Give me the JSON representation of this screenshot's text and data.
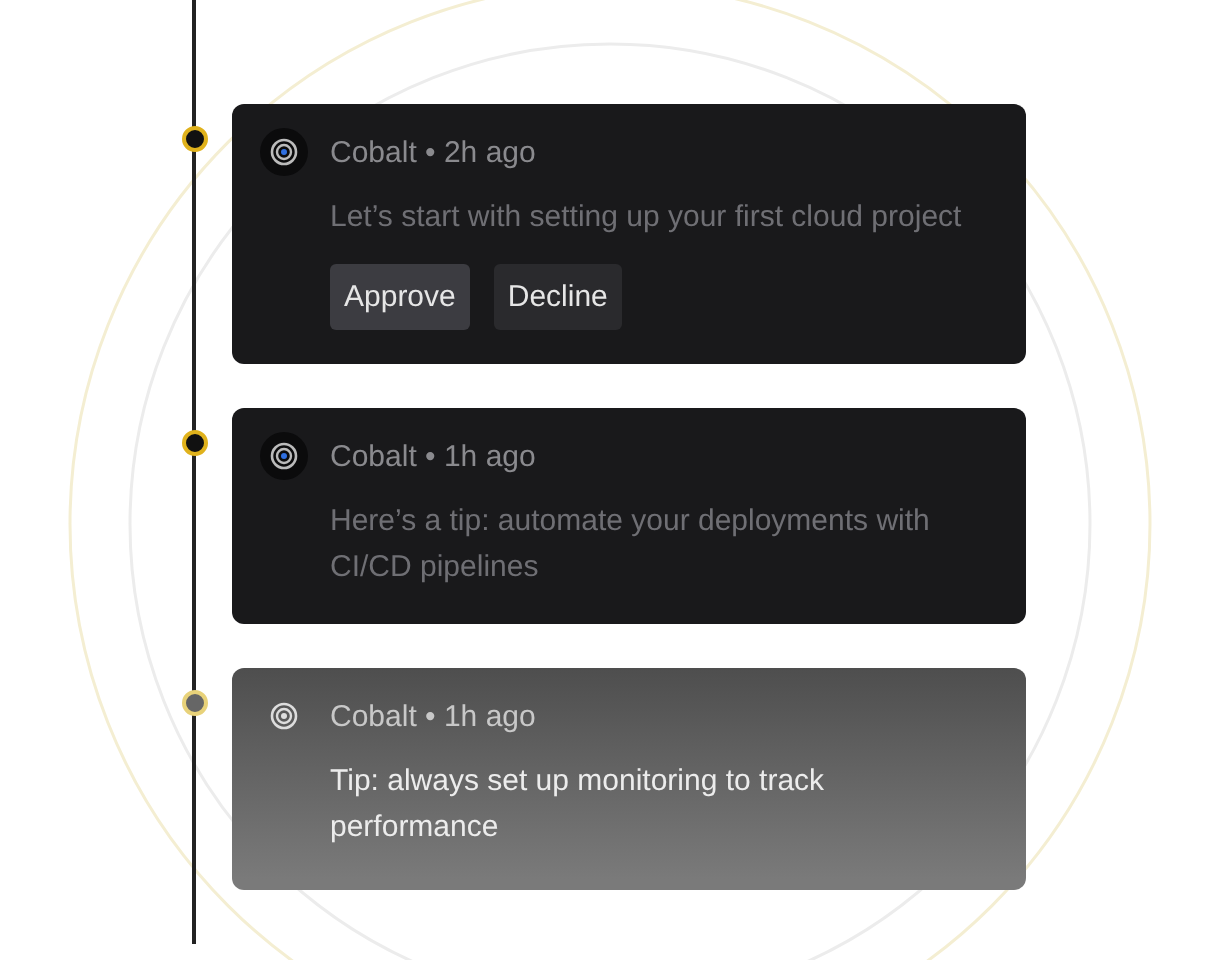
{
  "feed": [
    {
      "kind": "normal",
      "author": "Cobalt",
      "separator": "•",
      "time": "2h ago",
      "message": "Let’s start with setting up your first cloud project",
      "buttons": [
        {
          "label": "Approve",
          "kind": "primary"
        },
        {
          "label": "Decline",
          "kind": "secondary"
        }
      ]
    },
    {
      "kind": "normal",
      "author": "Cobalt",
      "separator": "•",
      "time": "1h ago",
      "message": "Here’s a tip: automate your deployments with CI/CD pipelines"
    },
    {
      "kind": "faded",
      "author": "Cobalt",
      "separator": "•",
      "time": "1h ago",
      "message": "Tip: always set up monitoring to track performance"
    }
  ]
}
